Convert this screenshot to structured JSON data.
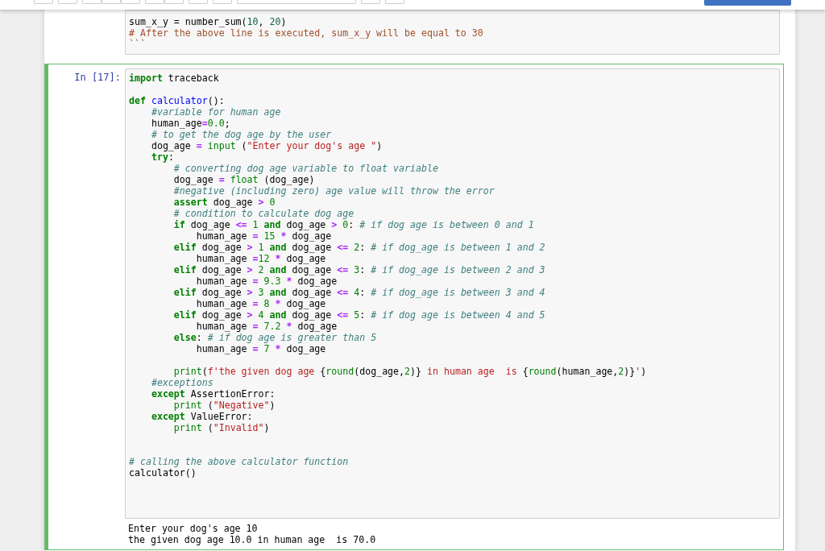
{
  "toolbar": {
    "buttons": [
      {
        "kind": "plain"
      },
      {
        "kind": "plain"
      },
      {
        "kind": "plain"
      },
      {
        "kind": "plain"
      },
      {
        "kind": "plain"
      },
      {
        "kind": "plain"
      },
      {
        "kind": "plain"
      },
      {
        "kind": "plain"
      },
      {
        "kind": "plain"
      },
      {
        "kind": "plain"
      },
      {
        "kind": "plain"
      },
      {
        "kind": "plain"
      },
      {
        "kind": "primary"
      }
    ]
  },
  "cells": [
    {
      "kind": "markdown",
      "selected": false,
      "lines": [
        {
          "kind": "code",
          "tokens": [
            {
              "kind": "text",
              "text": "sum_x_y = number_sum("
            },
            {
              "kind": "mdnum",
              "text": "10"
            },
            {
              "kind": "text",
              "text": ", "
            },
            {
              "kind": "mdnum",
              "text": "20"
            },
            {
              "kind": "text",
              "text": ")"
            }
          ]
        },
        {
          "kind": "code",
          "tokens": [
            {
              "kind": "mdcomment",
              "text": "# After the above line is executed, sum_x_y will be equal to 30"
            }
          ]
        },
        {
          "kind": "code",
          "tokens": [
            {
              "kind": "mdcomment",
              "text": "```"
            }
          ]
        }
      ]
    },
    {
      "kind": "code",
      "selected": true,
      "prompt": "In [17]:",
      "lines": [
        {
          "kind": "code",
          "tokens": [
            {
              "kind": "keyword",
              "text": "import"
            },
            {
              "kind": "text",
              "text": " traceback"
            }
          ]
        },
        {
          "kind": "blank"
        },
        {
          "kind": "code",
          "tokens": [
            {
              "kind": "keyword",
              "text": "def"
            },
            {
              "kind": "function",
              "text": " calculator"
            },
            {
              "kind": "text",
              "text": "():"
            }
          ]
        },
        {
          "kind": "code",
          "tokens": [
            {
              "kind": "comment",
              "text": "    #variable for human age"
            }
          ]
        },
        {
          "kind": "code",
          "tokens": [
            {
              "kind": "text",
              "text": "    human_age"
            },
            {
              "kind": "operator",
              "text": "="
            },
            {
              "kind": "number",
              "text": "0.0"
            },
            {
              "kind": "text",
              "text": ";"
            }
          ]
        },
        {
          "kind": "code",
          "tokens": [
            {
              "kind": "comment",
              "text": "    # to get the dog age by the user"
            }
          ]
        },
        {
          "kind": "code",
          "tokens": [
            {
              "kind": "text",
              "text": "    dog_age "
            },
            {
              "kind": "operator",
              "text": "="
            },
            {
              "kind": "builtin",
              "text": " input"
            },
            {
              "kind": "text",
              "text": " ("
            },
            {
              "kind": "string",
              "text": "\"Enter your dog's age \""
            },
            {
              "kind": "text",
              "text": ")"
            }
          ]
        },
        {
          "kind": "code",
          "tokens": [
            {
              "kind": "keyword",
              "text": "    try"
            },
            {
              "kind": "text",
              "text": ":"
            }
          ]
        },
        {
          "kind": "code",
          "tokens": [
            {
              "kind": "comment",
              "text": "        # converting dog age variable to float variable"
            }
          ]
        },
        {
          "kind": "code",
          "tokens": [
            {
              "kind": "text",
              "text": "        dog_age "
            },
            {
              "kind": "operator",
              "text": "="
            },
            {
              "kind": "builtin",
              "text": " float"
            },
            {
              "kind": "text",
              "text": " (dog_age)"
            }
          ]
        },
        {
          "kind": "code",
          "tokens": [
            {
              "kind": "comment",
              "text": "        #negative (including zero) age value will throw the error"
            }
          ]
        },
        {
          "kind": "code",
          "tokens": [
            {
              "kind": "keyword",
              "text": "        assert"
            },
            {
              "kind": "text",
              "text": " dog_age "
            },
            {
              "kind": "operator",
              "text": ">"
            },
            {
              "kind": "number",
              "text": " 0"
            }
          ]
        },
        {
          "kind": "code",
          "tokens": [
            {
              "kind": "comment",
              "text": "        # condition to calculate dog age"
            }
          ]
        },
        {
          "kind": "code",
          "tokens": [
            {
              "kind": "keyword",
              "text": "        if"
            },
            {
              "kind": "text",
              "text": " dog_age "
            },
            {
              "kind": "operator",
              "text": "<="
            },
            {
              "kind": "number",
              "text": " 1"
            },
            {
              "kind": "keyword",
              "text": " and"
            },
            {
              "kind": "text",
              "text": " dog_age "
            },
            {
              "kind": "operator",
              "text": ">"
            },
            {
              "kind": "number",
              "text": " 0"
            },
            {
              "kind": "text",
              "text": ": "
            },
            {
              "kind": "comment",
              "text": "# if dog age is between 0 and 1"
            }
          ]
        },
        {
          "kind": "code",
          "tokens": [
            {
              "kind": "text",
              "text": "            human_age "
            },
            {
              "kind": "operator",
              "text": "="
            },
            {
              "kind": "number",
              "text": " 15"
            },
            {
              "kind": "operator",
              "text": " *"
            },
            {
              "kind": "text",
              "text": " dog_age"
            }
          ]
        },
        {
          "kind": "code",
          "tokens": [
            {
              "kind": "keyword",
              "text": "        elif"
            },
            {
              "kind": "text",
              "text": " dog_age "
            },
            {
              "kind": "operator",
              "text": ">"
            },
            {
              "kind": "number",
              "text": " 1"
            },
            {
              "kind": "keyword",
              "text": " and"
            },
            {
              "kind": "text",
              "text": " dog_age "
            },
            {
              "kind": "operator",
              "text": "<="
            },
            {
              "kind": "number",
              "text": " 2"
            },
            {
              "kind": "text",
              "text": ": "
            },
            {
              "kind": "comment",
              "text": "# if dog_age is between 1 and 2"
            }
          ]
        },
        {
          "kind": "code",
          "tokens": [
            {
              "kind": "text",
              "text": "            human_age "
            },
            {
              "kind": "operator",
              "text": "="
            },
            {
              "kind": "number",
              "text": "12"
            },
            {
              "kind": "operator",
              "text": " *"
            },
            {
              "kind": "text",
              "text": " dog_age"
            }
          ]
        },
        {
          "kind": "code",
          "tokens": [
            {
              "kind": "keyword",
              "text": "        elif"
            },
            {
              "kind": "text",
              "text": " dog_age "
            },
            {
              "kind": "operator",
              "text": ">"
            },
            {
              "kind": "number",
              "text": " 2"
            },
            {
              "kind": "keyword",
              "text": " and"
            },
            {
              "kind": "text",
              "text": " dog_age "
            },
            {
              "kind": "operator",
              "text": "<="
            },
            {
              "kind": "number",
              "text": " 3"
            },
            {
              "kind": "text",
              "text": ": "
            },
            {
              "kind": "comment",
              "text": "# if dog_age is between 2 and 3"
            }
          ]
        },
        {
          "kind": "code",
          "tokens": [
            {
              "kind": "text",
              "text": "            human_age "
            },
            {
              "kind": "operator",
              "text": "="
            },
            {
              "kind": "number",
              "text": " 9.3"
            },
            {
              "kind": "operator",
              "text": " *"
            },
            {
              "kind": "text",
              "text": " dog_age"
            }
          ]
        },
        {
          "kind": "code",
          "tokens": [
            {
              "kind": "keyword",
              "text": "        elif"
            },
            {
              "kind": "text",
              "text": " dog_age "
            },
            {
              "kind": "operator",
              "text": ">"
            },
            {
              "kind": "number",
              "text": " 3"
            },
            {
              "kind": "keyword",
              "text": " and"
            },
            {
              "kind": "text",
              "text": " dog_age "
            },
            {
              "kind": "operator",
              "text": "<="
            },
            {
              "kind": "number",
              "text": " 4"
            },
            {
              "kind": "text",
              "text": ": "
            },
            {
              "kind": "comment",
              "text": "# if dog_age is between 3 and 4"
            }
          ]
        },
        {
          "kind": "code",
          "tokens": [
            {
              "kind": "text",
              "text": "            human_age "
            },
            {
              "kind": "operator",
              "text": "="
            },
            {
              "kind": "number",
              "text": " 8"
            },
            {
              "kind": "operator",
              "text": " *"
            },
            {
              "kind": "text",
              "text": " dog_age"
            }
          ]
        },
        {
          "kind": "code",
          "tokens": [
            {
              "kind": "keyword",
              "text": "        elif"
            },
            {
              "kind": "text",
              "text": " dog_age "
            },
            {
              "kind": "operator",
              "text": ">"
            },
            {
              "kind": "number",
              "text": " 4"
            },
            {
              "kind": "keyword",
              "text": " and"
            },
            {
              "kind": "text",
              "text": " dog_age "
            },
            {
              "kind": "operator",
              "text": "<="
            },
            {
              "kind": "number",
              "text": " 5"
            },
            {
              "kind": "text",
              "text": ": "
            },
            {
              "kind": "comment",
              "text": "# if dog age is between 4 and 5"
            }
          ]
        },
        {
          "kind": "code",
          "tokens": [
            {
              "kind": "text",
              "text": "            human_age "
            },
            {
              "kind": "operator",
              "text": "="
            },
            {
              "kind": "number",
              "text": " 7.2"
            },
            {
              "kind": "operator",
              "text": " *"
            },
            {
              "kind": "text",
              "text": " dog_age"
            }
          ]
        },
        {
          "kind": "code",
          "tokens": [
            {
              "kind": "keyword",
              "text": "        else"
            },
            {
              "kind": "text",
              "text": ": "
            },
            {
              "kind": "comment",
              "text": "# if dog age is greater than 5"
            }
          ]
        },
        {
          "kind": "code",
          "tokens": [
            {
              "kind": "text",
              "text": "            human_age "
            },
            {
              "kind": "operator",
              "text": "="
            },
            {
              "kind": "number",
              "text": " 7"
            },
            {
              "kind": "operator",
              "text": " *"
            },
            {
              "kind": "text",
              "text": " dog_age"
            }
          ]
        },
        {
          "kind": "blank"
        },
        {
          "kind": "code",
          "tokens": [
            {
              "kind": "builtin",
              "text": "        print"
            },
            {
              "kind": "text",
              "text": "("
            },
            {
              "kind": "string",
              "text": "f'the given dog age "
            },
            {
              "kind": "text",
              "text": "{"
            },
            {
              "kind": "builtin",
              "text": "round"
            },
            {
              "kind": "text",
              "text": "(dog_age,"
            },
            {
              "kind": "number",
              "text": "2"
            },
            {
              "kind": "text",
              "text": ")}"
            },
            {
              "kind": "string",
              "text": " in human age  is "
            },
            {
              "kind": "text",
              "text": "{"
            },
            {
              "kind": "builtin",
              "text": "round"
            },
            {
              "kind": "text",
              "text": "(human_age,"
            },
            {
              "kind": "number",
              "text": "2"
            },
            {
              "kind": "text",
              "text": ")}"
            },
            {
              "kind": "string",
              "text": "'"
            },
            {
              "kind": "text",
              "text": ")"
            }
          ]
        },
        {
          "kind": "code",
          "tokens": [
            {
              "kind": "comment",
              "text": "    #exceptions"
            }
          ]
        },
        {
          "kind": "code",
          "tokens": [
            {
              "kind": "keyword",
              "text": "    except"
            },
            {
              "kind": "text",
              "text": " AssertionError:"
            }
          ]
        },
        {
          "kind": "code",
          "tokens": [
            {
              "kind": "builtin",
              "text": "        print"
            },
            {
              "kind": "text",
              "text": " ("
            },
            {
              "kind": "string",
              "text": "\"Negative\""
            },
            {
              "kind": "text",
              "text": ")"
            }
          ]
        },
        {
          "kind": "code",
          "tokens": [
            {
              "kind": "keyword",
              "text": "    except"
            },
            {
              "kind": "text",
              "text": " ValueError:"
            }
          ]
        },
        {
          "kind": "code",
          "tokens": [
            {
              "kind": "builtin",
              "text": "        print"
            },
            {
              "kind": "text",
              "text": " ("
            },
            {
              "kind": "string",
              "text": "\"Invalid\""
            },
            {
              "kind": "text",
              "text": ")"
            }
          ]
        },
        {
          "kind": "blank"
        },
        {
          "kind": "blank"
        },
        {
          "kind": "code",
          "tokens": [
            {
              "kind": "comment",
              "text": "# calling the above calculator function"
            }
          ]
        },
        {
          "kind": "code",
          "tokens": [
            {
              "kind": "text",
              "text": "calculator()"
            }
          ]
        }
      ],
      "output": [
        "Enter your dog's age 10",
        "the given dog age 10.0 in human age  is 70.0"
      ]
    }
  ]
}
